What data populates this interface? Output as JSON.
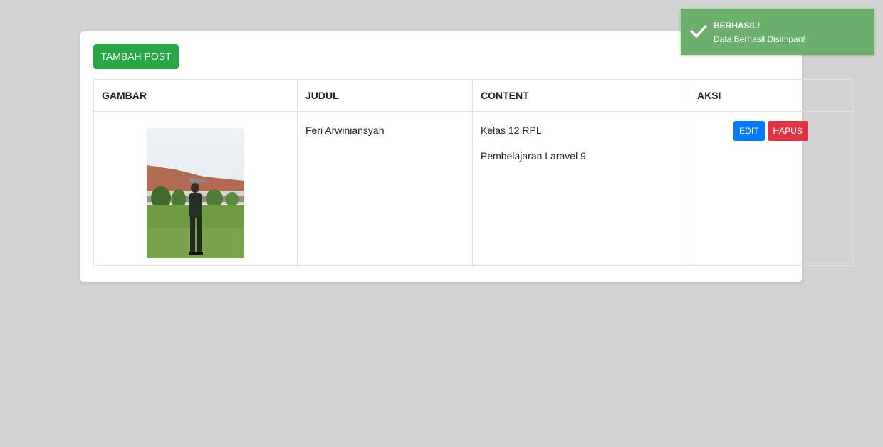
{
  "toolbar": {
    "add_label": "TAMBAH POST"
  },
  "table": {
    "headers": [
      "GAMBAR",
      "JUDUL",
      "CONTENT",
      "AKSI"
    ],
    "rows": [
      {
        "gambar": "photo-of-person",
        "judul": "Feri Arwiniansyah",
        "content": [
          "Kelas 12 RPL",
          "Pembelajaran Laravel 9"
        ],
        "actions": {
          "edit": "EDIT",
          "hapus": "HAPUS"
        }
      }
    ]
  },
  "toast": {
    "title": "BERHASIL!",
    "message": "Data Berhasil Disimpan!",
    "icon": "check-icon",
    "color": "#6aaf6a"
  },
  "colors": {
    "add": "#28a745",
    "edit": "#007bff",
    "hapus": "#dc3545",
    "background": "#d3d3d3"
  }
}
